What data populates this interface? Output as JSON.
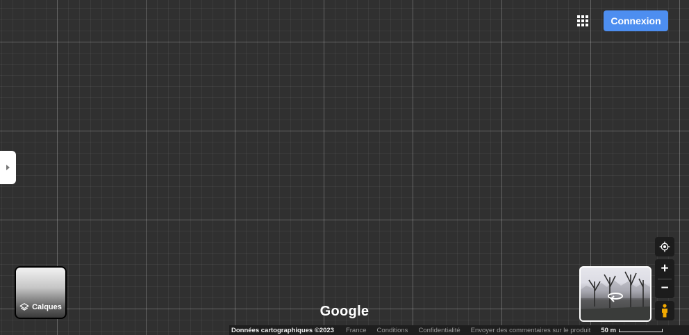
{
  "header": {
    "apps_icon": "apps-grid-icon",
    "signin_label": "Connexion"
  },
  "sidebar": {
    "toggle_icon": "chevron-right-icon"
  },
  "layers": {
    "label": "Calques",
    "icon": "layers-icon"
  },
  "logo": {
    "text": "Google"
  },
  "footer": {
    "map_data": "Données cartographiques ©2023",
    "links": [
      "France",
      "Conditions",
      "Confidentialité",
      "Envoyer des commentaires sur le produit"
    ],
    "scale_label": "50 m"
  },
  "controls": {
    "locate_icon": "my-location-icon",
    "zoom_in_label": "+",
    "zoom_out_label": "−",
    "pegman_icon": "pegman-icon",
    "street_view_icon": "rotate-360-icon"
  },
  "colors": {
    "background": "#303030",
    "accent": "#4d8ef0",
    "pegman": "#f2a900"
  }
}
